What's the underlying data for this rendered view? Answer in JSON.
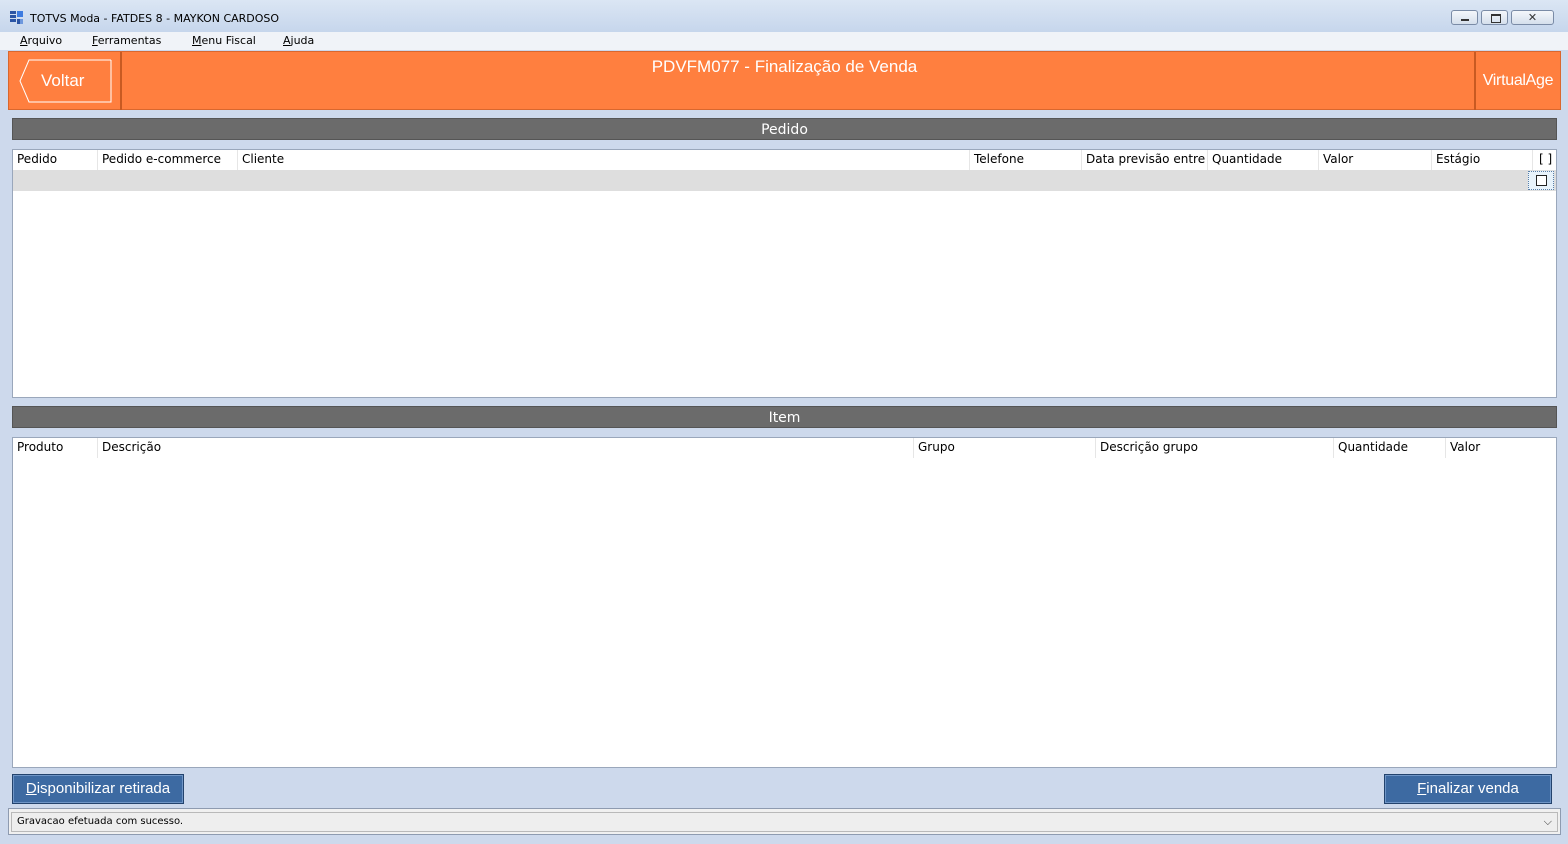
{
  "window": {
    "title": "TOTVS Moda - FATDES 8 - MAYKON CARDOSO"
  },
  "menu": {
    "items": [
      {
        "key": "A",
        "rest": "rquivo"
      },
      {
        "key": "F",
        "rest": "erramentas"
      },
      {
        "key": "M",
        "rest": "enu Fiscal"
      },
      {
        "key": "A",
        "rest": "juda"
      }
    ]
  },
  "header": {
    "back_label": "Voltar",
    "title": "PDVFM077 - Finalização de Venda",
    "brand": "VirtualAge",
    "color": "#ff7f3f"
  },
  "pedido": {
    "section_title": "Pedido",
    "columns": [
      "Pedido",
      "Pedido e-commerce",
      "Cliente",
      "Telefone",
      "Data previsão entre",
      "Quantidade",
      "Valor",
      "Estágio",
      "[ ]"
    ],
    "rows": [
      {
        "cells": [
          "",
          "",
          "",
          "",
          "",
          "",
          "",
          ""
        ],
        "checked": false
      }
    ]
  },
  "item": {
    "section_title": "Item",
    "columns": [
      "Produto",
      "Descrição",
      "Grupo",
      "Descrição grupo",
      "Quantidade",
      "Valor"
    ],
    "rows": []
  },
  "actions": {
    "release": {
      "key": "D",
      "rest": "isponibilizar retirada"
    },
    "finish": {
      "key": "F",
      "rest": "inalizar venda"
    }
  },
  "status": {
    "message": "Gravacao efetuada com sucesso."
  },
  "colors": {
    "section_bar": "#6b6b6b",
    "button_blue": "#3d6aa2",
    "background": "#cdd9ec"
  }
}
